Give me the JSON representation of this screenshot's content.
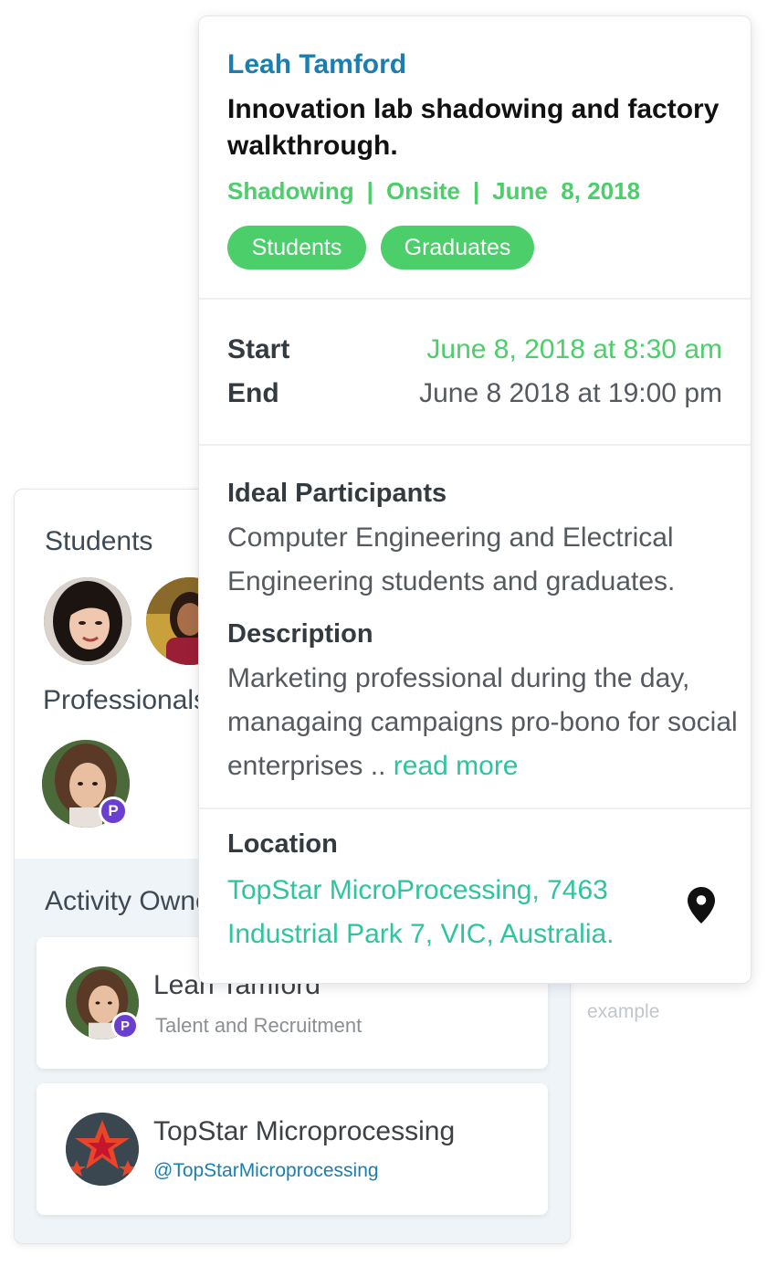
{
  "back_card": {
    "students_title": "Students",
    "professionals_title": "Professionals",
    "activity_owners_title": "Activity Owners",
    "badge_letter": "P",
    "owners": [
      {
        "name": "Leah Tamford",
        "subtitle": "Talent and Recruitment"
      },
      {
        "name": "TopStar Microprocessing",
        "handle": "@TopStarMicroprocessing"
      }
    ],
    "example_label": "example"
  },
  "event": {
    "host": "Leah Tamford",
    "title": "Innovation lab shadowing and factory walkthrough.",
    "type": "Shadowing",
    "mode": "Onsite",
    "date": "June  8, 2018",
    "tags": [
      "Students",
      "Graduates"
    ],
    "start_label": "Start",
    "start_value": "June 8, 2018 at 8:30 am",
    "end_label": "End",
    "end_value": "June 8 2018 at 19:00 pm",
    "ideal_participants_heading": "Ideal Participants",
    "ideal_participants": "Computer Engineering and Electrical Engineering students and graduates.",
    "description_heading": "Description",
    "description": "Marketing professional during the day, managaing campaigns pro-bono for social enterprises ..",
    "read_more": "read more",
    "location_heading": "Location",
    "location": "TopStar MicroProcessing, 7463 Industrial Park 7, VIC, Australia."
  },
  "colors": {
    "accent_blue": "#1a7fb0",
    "accent_green": "#4cce6a",
    "accent_teal": "#2dc4a0",
    "badge_purple": "#6a3fd0"
  },
  "icons": [
    "location-pin-icon",
    "star-logo-icon"
  ]
}
